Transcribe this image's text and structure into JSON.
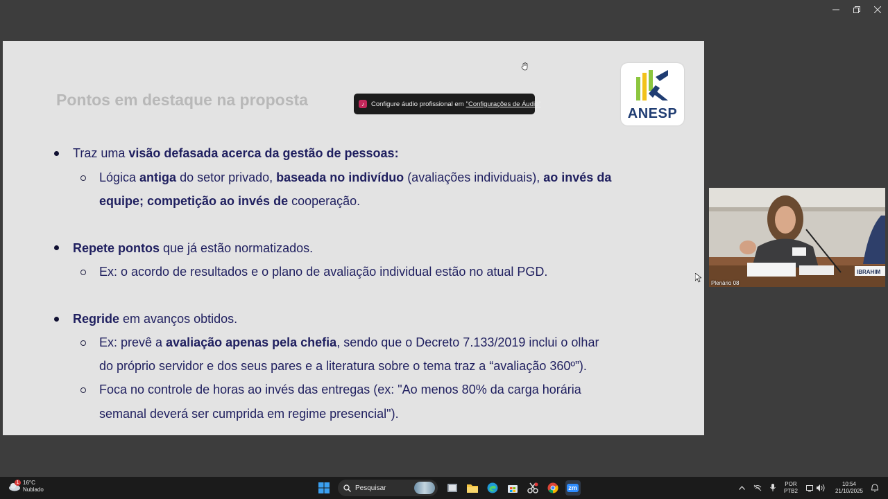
{
  "window": {
    "controls": [
      "minimize",
      "restore",
      "close"
    ]
  },
  "toast": {
    "text": "Configure áudio profissional em",
    "link": "\"Configurações de Áudio\""
  },
  "slide": {
    "title": "Pontos em destaque na proposta",
    "logo_text": "ANESP",
    "bullet1": {
      "plain1": "Traz uma ",
      "bold1": "visão defasada acerca da gestão de pessoas:"
    },
    "bullet1_sub1": {
      "p1": "Lógica ",
      "b1": "antiga",
      "p2": " do setor privado, ",
      "b2": "baseada no indivíduo",
      "p3": " (avaliações individuais), ",
      "b3": "ao invés da",
      "b4": "equipe; competição ao invés de",
      "p4": " cooperação."
    },
    "bullet2": {
      "bold1": "Repete pontos",
      "plain1": " que já estão normatizados."
    },
    "bullet2_sub1": "Ex: o acordo de resultados e o plano de avaliação individual estão no atual PGD.",
    "bullet3": {
      "bold1": "Regride",
      "plain1": " em avanços obtidos."
    },
    "bullet3_sub1": {
      "p1": "Ex: prevê a ",
      "b1": "avaliação apenas pela chefia",
      "p2": ", sendo que o Decreto 7.133/2019 inclui o olhar",
      "p3": "do próprio servidor e dos seus pares e a literatura sobre o tema traz a “avaliação 360º”)."
    },
    "bullet3_sub2": {
      "p1": "Foca no controle de horas ao invés das entregas (ex: \"Ao menos 80% da carga horária",
      "p2": "semanal deverá ser cumprida em regime presencial\")."
    }
  },
  "video": {
    "label": "Plenário 08",
    "nameplate": "IBRAHIM"
  },
  "taskbar": {
    "weather_temp": "16°C",
    "weather_desc": "Nublado",
    "weather_badge": "1",
    "search_placeholder": "Pesquisar",
    "apps": [
      "windows-start",
      "search",
      "task-view",
      "file-explorer",
      "edge",
      "store",
      "snipping-tool",
      "chrome",
      "zoom"
    ],
    "zoom_label": "zm",
    "lang_top": "POR",
    "lang_bottom": "PTB2",
    "time": "10:54",
    "date": "21/10/2025"
  },
  "colors": {
    "slide_bg": "#e3e3e3",
    "text_navy": "#1f1f5f",
    "logo_blue": "#1f3c72",
    "logo_green": "#8cc63f",
    "logo_yellow": "#f2c21b",
    "taskbar_bg": "#1b1b1b"
  }
}
